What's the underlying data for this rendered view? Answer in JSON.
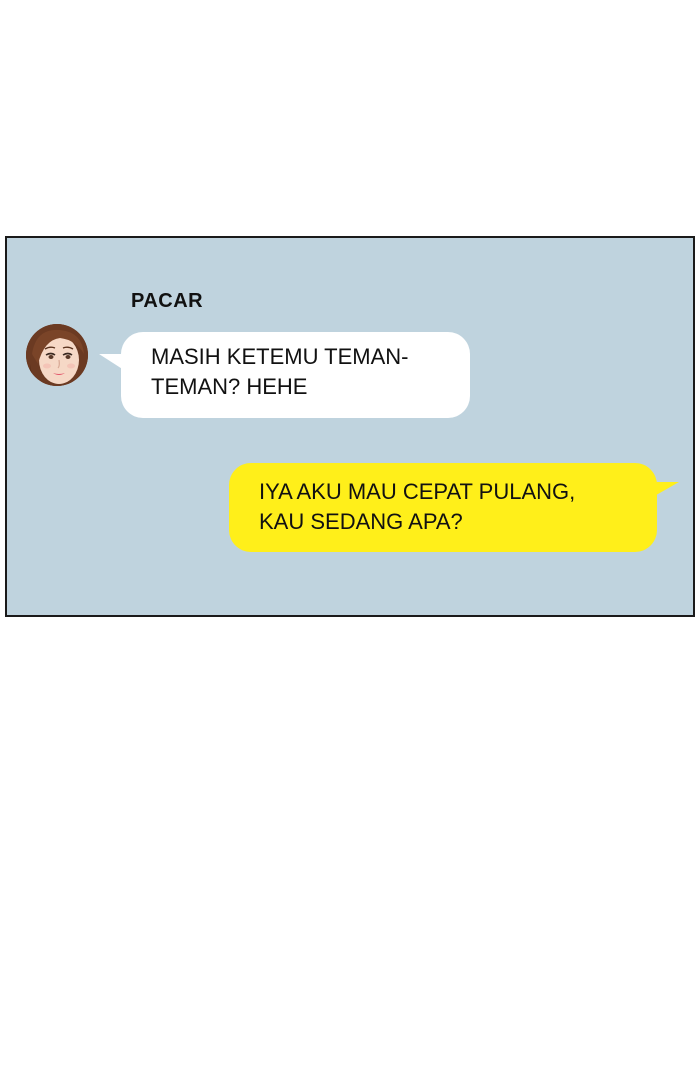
{
  "chat": {
    "sender_name": "PACAR",
    "incoming_message": {
      "line1": "MASIH KETEMU TEMAN-",
      "line2": "TEMAN? HEHE"
    },
    "outgoing_message": {
      "line1": "IYA AKU MAU CEPAT PULANG,",
      "line2": "KAU SEDANG APA?"
    }
  },
  "colors": {
    "panel_background": "#bfd3de",
    "incoming_bubble": "#ffffff",
    "outgoing_bubble": "#ffef1a",
    "panel_border": "#1a1a1a"
  },
  "icons": {
    "avatar": "girlfriend-avatar-icon"
  }
}
